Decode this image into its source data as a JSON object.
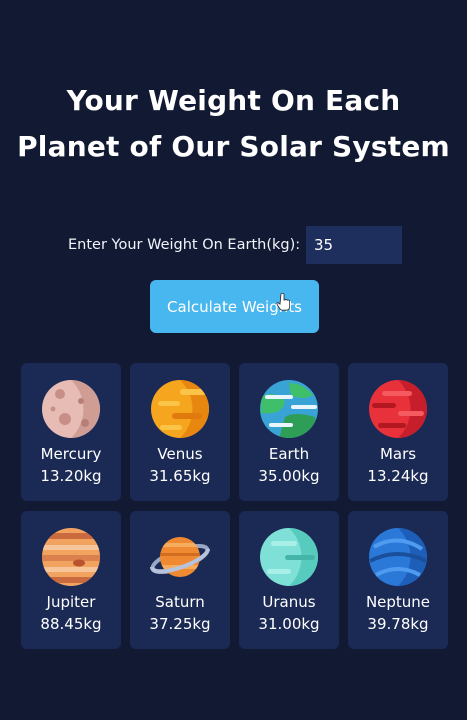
{
  "title": {
    "line1": "Your Weight On Each",
    "line2": "Planet of Our Solar System"
  },
  "form": {
    "label": "Enter Your Weight On Earth(kg):",
    "weight_value": "35",
    "button_label": "Calculate Weights"
  },
  "planets": [
    {
      "name": "Mercury",
      "weight": "13.20kg",
      "icon": "mercury-icon"
    },
    {
      "name": "Venus",
      "weight": "31.65kg",
      "icon": "venus-icon"
    },
    {
      "name": "Earth",
      "weight": "35.00kg",
      "icon": "earth-icon"
    },
    {
      "name": "Mars",
      "weight": "13.24kg",
      "icon": "mars-icon"
    },
    {
      "name": "Jupiter",
      "weight": "88.45kg",
      "icon": "jupiter-icon"
    },
    {
      "name": "Saturn",
      "weight": "37.25kg",
      "icon": "saturn-icon"
    },
    {
      "name": "Uranus",
      "weight": "31.00kg",
      "icon": "uranus-icon"
    },
    {
      "name": "Neptune",
      "weight": "39.78kg",
      "icon": "neptune-icon"
    }
  ],
  "colors": {
    "background": "#121a33",
    "card": "#1b2a55",
    "input": "#1e2f5e",
    "button": "#49b7ef"
  }
}
